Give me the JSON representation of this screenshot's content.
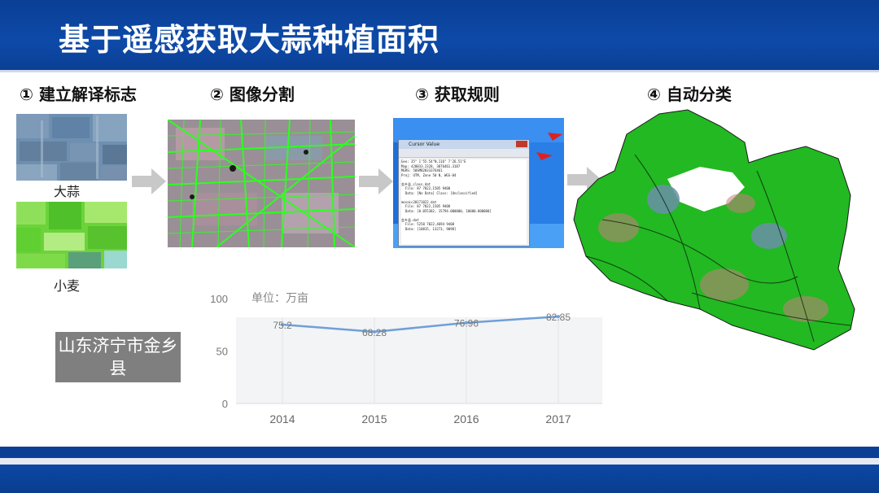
{
  "title": "基于遥感获取大蒜种植面积",
  "steps": [
    {
      "label": "① 建立解译标志"
    },
    {
      "label": "② 图像分割"
    },
    {
      "label": "③ 获取规则"
    },
    {
      "label": "④ 自动分类"
    }
  ],
  "samples": {
    "garlic_label": "大蒜",
    "wheat_label": "小麦"
  },
  "region_label": "山东济宁市金乡县",
  "cursor_window": {
    "title": "Cursor Value",
    "lines": [
      "Geo: 35° 1'55.54\"N,116° 7'26.51\"E",
      "Map: 420033.2328, 3876461.3187",
      "MGRS: 50SMB2033376461",
      "Proj: UTM, Zone 50 N, WGS-84",
      "",
      "金乡县_class.dat",
      "  File: 87 7022,1505 9408",
      "  Data: [No Data] Class: [Unclassified]",
      "",
      "mosaic20171022.dat",
      "  File: 87 7022,1505 9408",
      "  Data: [0.055382, 15794.000000, 10000.000000]",
      "",
      "金乡县.dat",
      "  File: 5258 7022,4694 9408",
      "  Data: [10815, 13273, 9098]"
    ]
  },
  "chart_data": {
    "type": "line",
    "title": "单位：万亩",
    "categories": [
      "2014",
      "2015",
      "2016",
      "2017"
    ],
    "values": [
      75.2,
      68.28,
      76.96,
      82.85
    ],
    "data_labels": [
      "75.2",
      "68.28",
      "76.96",
      "82.85"
    ],
    "ylim": [
      0,
      100
    ],
    "yticks": [
      "0",
      "50",
      "100"
    ],
    "grid": true,
    "line_color": "#6fa0d8"
  }
}
